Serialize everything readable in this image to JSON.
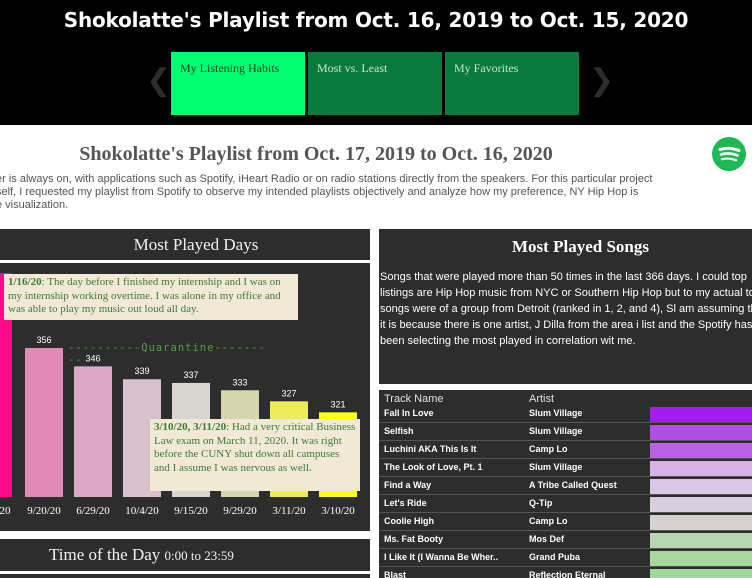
{
  "header": {
    "title": "Shokolatte's Playlist from Oct. 16, 2019 to Oct. 15, 2020",
    "prev_arrow": "❮",
    "next_arrow": "❯",
    "tabs": [
      {
        "label": "My Listening Habits",
        "active": true
      },
      {
        "label": "Most vs. Least",
        "active": false
      },
      {
        "label": "My Favorites",
        "active": false
      }
    ]
  },
  "page": {
    "title": "Shokolatte's Playlist from Oct. 17, 2019 to Oct. 16, 2020",
    "intro_lines": [
      "er is always on, with applications such as Spotify, iHeart Radio or on radio stations directly from the speakers.  For this particular project",
      "self, I requested my playlist from Spotify to observe my intended playlists objectively and analyze how my preference, NY Hip Hop is",
      "e visualization."
    ]
  },
  "most_played_days": {
    "title": "Most Played Days",
    "note1_date": "1/16/20",
    "note1_text": ": The day before I finished my internship and I was on my internship working overtime.  I was alone in my office and was able to play my music out loud all day.",
    "note2_date": "3/10/20, 3/11/20",
    "note2_text": ": Had a very critical Business Law exam on March 11, 2020.  It was right before the CUNY shut down all campuses and I assume I was nervous as well.",
    "quarantine_label": "----------Quarantine---------"
  },
  "chart_data": {
    "type": "bar",
    "categories": [
      "20",
      "9/20/20",
      "6/29/20",
      "10/4/20",
      "9/15/20",
      "9/29/20",
      "3/11/20",
      "3/10/20"
    ],
    "values": [
      null,
      356,
      346,
      339,
      337,
      333,
      327,
      321
    ],
    "colors": [
      "#ff0a8c",
      "#e08ab8",
      "#dca8c4",
      "#d8c0cc",
      "#d9d6d2",
      "#d6d6ae",
      "#ecec5a",
      "#ffff14"
    ],
    "title": "Most Played Days"
  },
  "time_of_day": {
    "title": "Time of the Day",
    "range": "0:00 to 23:59"
  },
  "most_played_songs": {
    "title": "Most Played Songs",
    "description": "Songs that were played more than 50 times in the last 366 days.  I could top listings are Hip Hop music from NYC or Southern Hip Hop but to my actual top songs were of a group from Detroit (ranked in 1, 2, and 4), Sl am assuming that it is because there is one artist, J Dilla from the area i list and the Spotify has been selecting the most played in correlation wit me.",
    "columns": [
      "Track Name",
      "Artist"
    ],
    "rows": [
      {
        "track": "Fall In Love",
        "artist": "Slum Village",
        "color": "#a31cf0"
      },
      {
        "track": "Selfish",
        "artist": "Slum Village",
        "color": "#b04fe6"
      },
      {
        "track": "Luchini AKA This Is It",
        "artist": "Camp Lo",
        "color": "#b862e6"
      },
      {
        "track": "The Look of Love, Pt. 1",
        "artist": "Slum Village",
        "color": "#d6b2e6"
      },
      {
        "track": "Find a Way",
        "artist": "A Tribe Called Quest",
        "color": "#dcc6e6"
      },
      {
        "track": "Let's Ride",
        "artist": "Q-Tip",
        "color": "#d7cddd"
      },
      {
        "track": "Coolie High",
        "artist": "Camp Lo",
        "color": "#d4d2cf"
      },
      {
        "track": "Ms. Fat Booty",
        "artist": "Mos Def",
        "color": "#b9d6b0"
      },
      {
        "track": "I Like It (I Wanna Be Wher..",
        "artist": "Grand Puba",
        "color": "#a8d7a0"
      },
      {
        "track": "Blast",
        "artist": "Reflection Eternal",
        "color": "#9fd69a"
      }
    ]
  }
}
